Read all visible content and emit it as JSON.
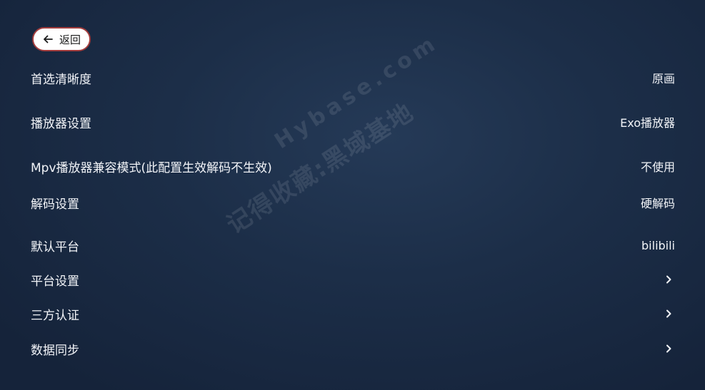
{
  "header": {
    "back_label": "返回"
  },
  "settings": [
    {
      "label": "首选清晰度",
      "value": "原画"
    },
    {
      "label": "播放器设置",
      "value": "Exo播放器"
    },
    {
      "label": "Mpv播放器兼容模式(此配置生效解码不生效)",
      "value": "不使用"
    },
    {
      "label": "解码设置",
      "value": "硬解码"
    },
    {
      "label": "默认平台",
      "value": "bilibili"
    },
    {
      "label": "平台设置",
      "icon": "chevron-right-icon"
    },
    {
      "label": "三方认证",
      "icon": "chevron-right-icon"
    },
    {
      "label": "数据同步",
      "icon": "chevron-right-icon"
    }
  ],
  "watermark": {
    "line1": "记得收藏:黑域基地",
    "line2": "Hybase.com"
  },
  "colors": {
    "background": "#1c2e48",
    "text": "#f2f4f8",
    "back_button_bg": "#ffffff",
    "back_button_border": "#a23c3c"
  }
}
